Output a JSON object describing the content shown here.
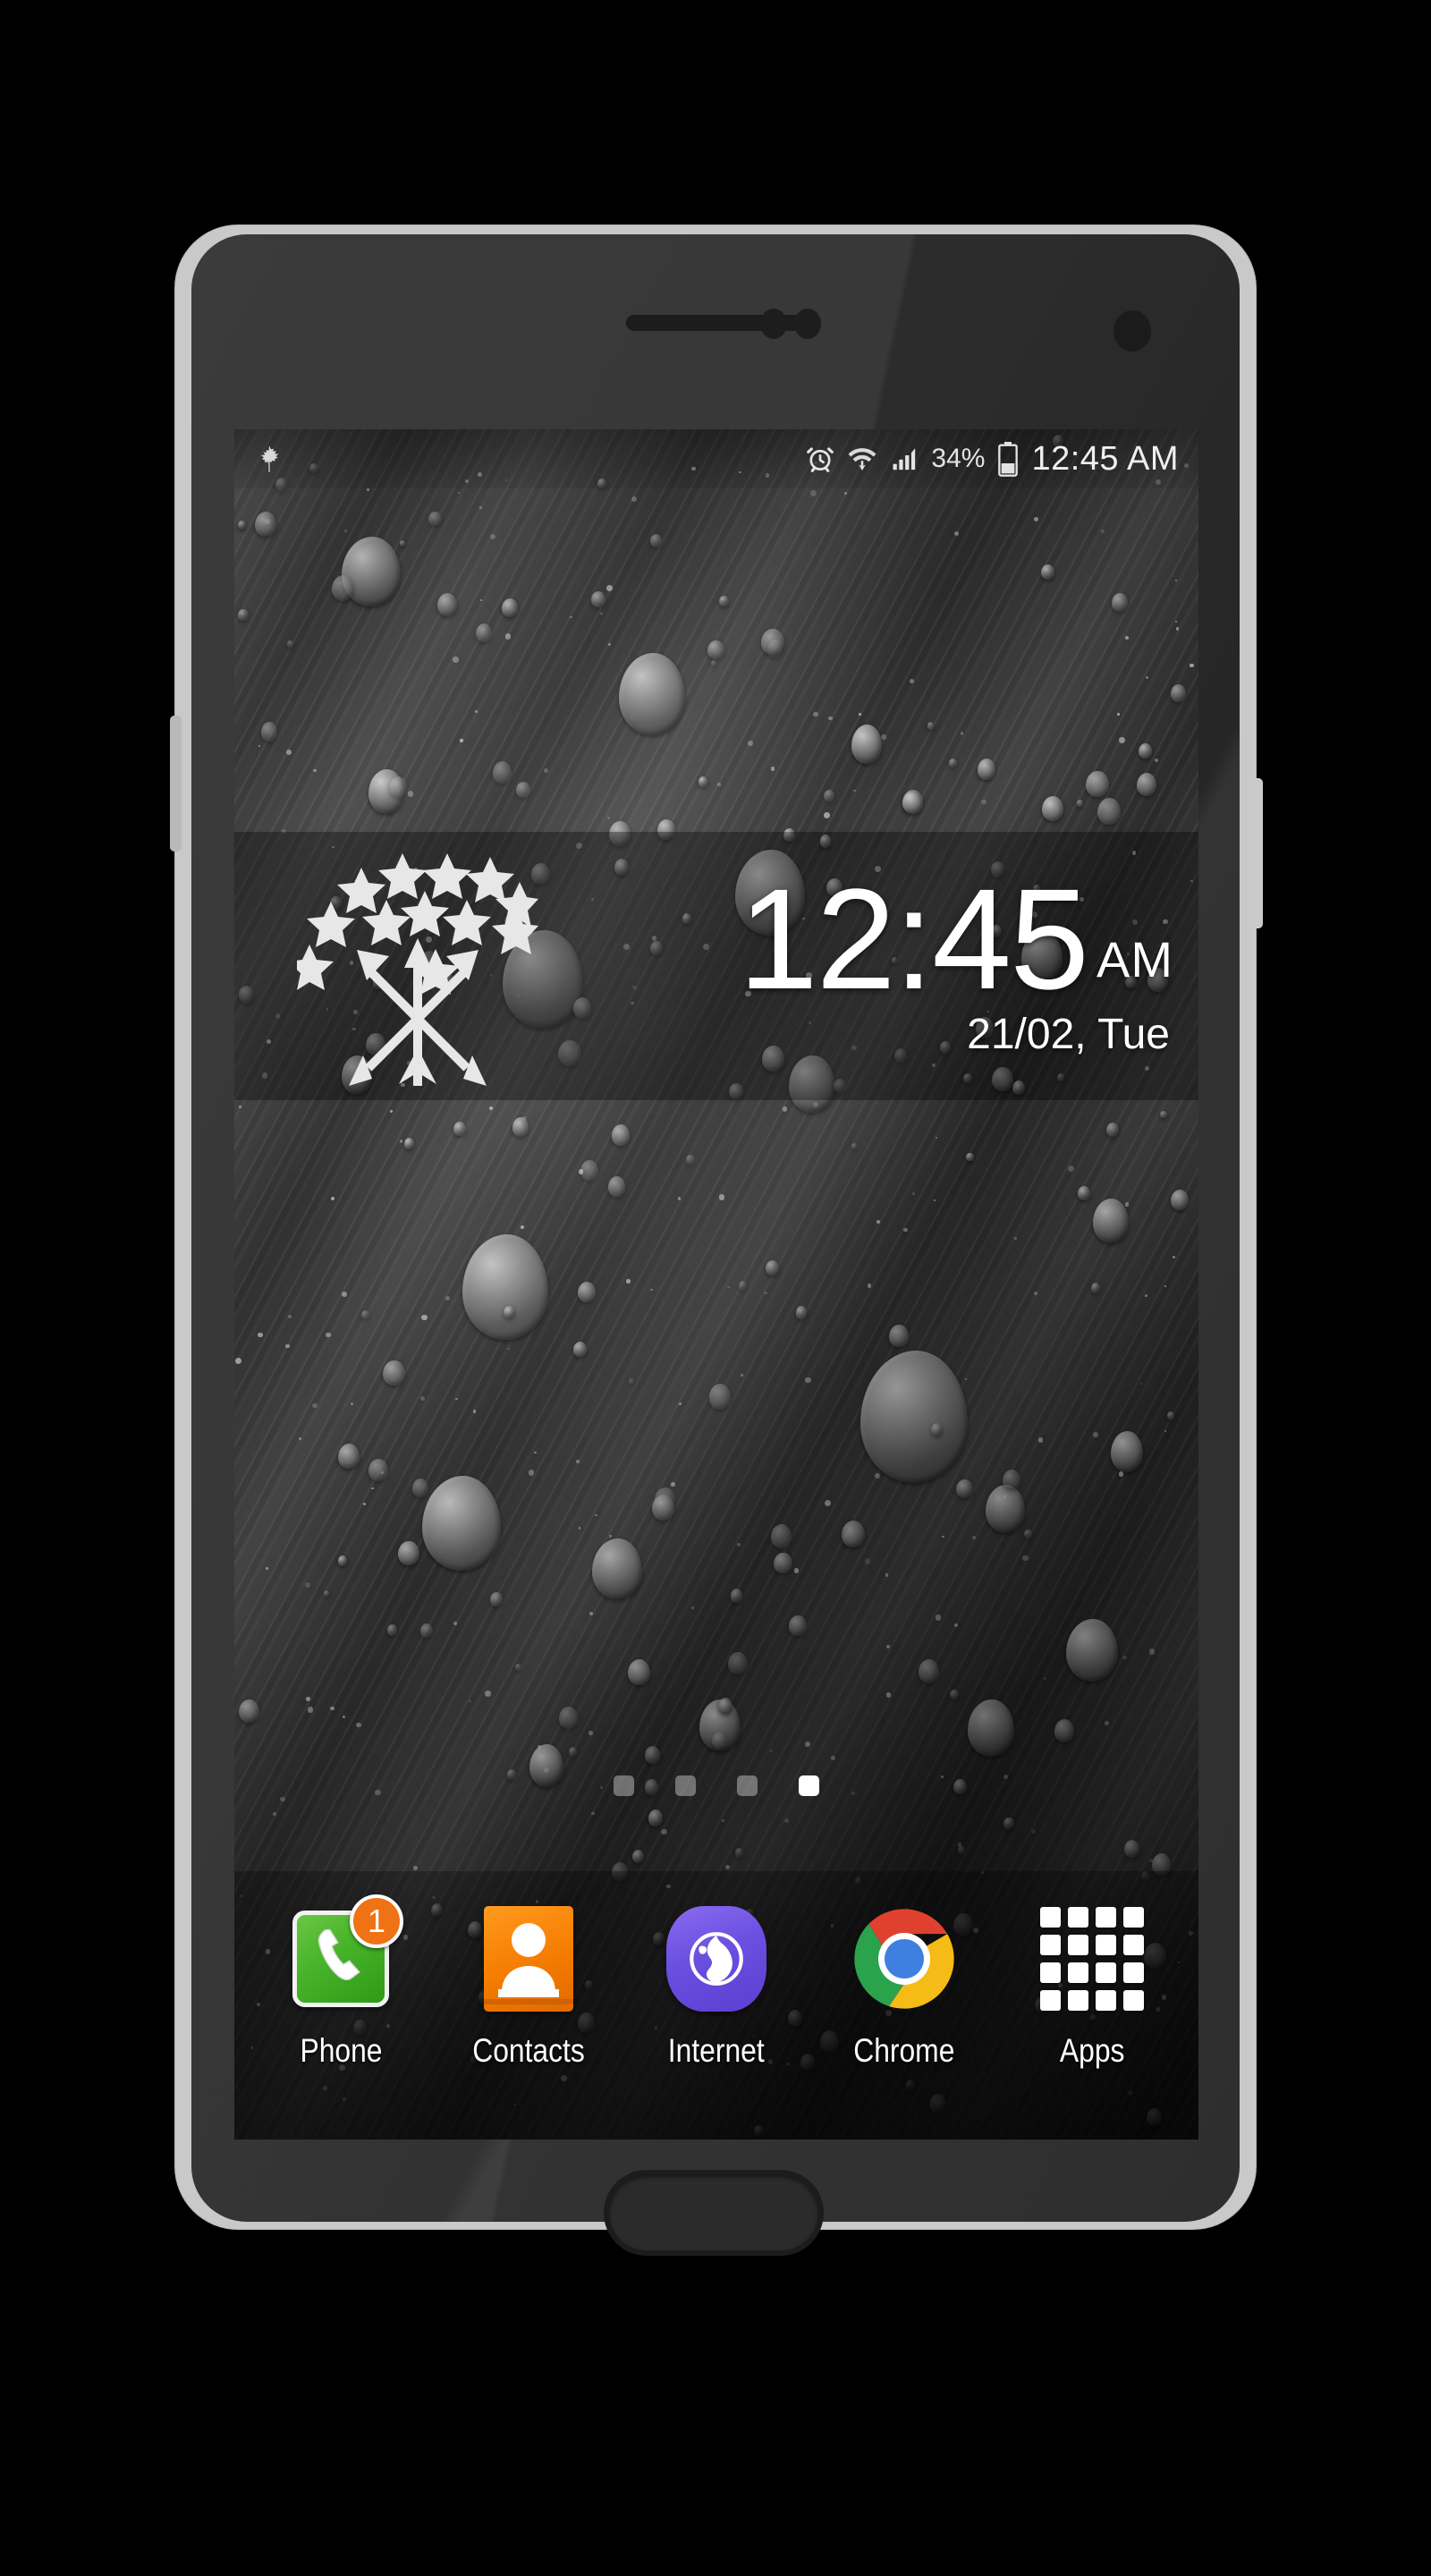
{
  "device": {
    "type": "android-smartphone",
    "bezel_color": "#c9c9c9",
    "body_color": "#2e2e2e",
    "hardware": {
      "earpiece": "earpiece-speaker",
      "front_camera": "front-camera",
      "home_button": "home-button",
      "power_button": "power-button",
      "volume_button": "volume-button"
    }
  },
  "status_bar": {
    "notification_icon": "maple-leaf-icon",
    "icons": [
      "alarm-icon",
      "wifi-icon",
      "signal-icon",
      "battery-icon"
    ],
    "battery_percent": "34%",
    "clock": "12:45 AM"
  },
  "clock_widget": {
    "emblem": "stars-and-arrows-emblem",
    "star_count": 13,
    "arrow_count": 3,
    "time": "12:45",
    "ampm": "AM",
    "date": "21/02, Tue"
  },
  "page_indicator": {
    "total": 4,
    "active_index": 3
  },
  "dock": {
    "items": [
      {
        "label": "Phone",
        "icon": "phone-icon",
        "badge": "1",
        "color": "#49b52b"
      },
      {
        "label": "Contacts",
        "icon": "contacts-icon",
        "badge": null,
        "color": "#f57c00"
      },
      {
        "label": "Internet",
        "icon": "globe-icon",
        "badge": null,
        "color": "#6a4fe0"
      },
      {
        "label": "Chrome",
        "icon": "chrome-icon",
        "badge": null,
        "color": "#4285f4"
      },
      {
        "label": "Apps",
        "icon": "apps-grid-icon",
        "badge": null,
        "color": "#ffffff"
      }
    ]
  },
  "wallpaper": {
    "description": "grayscale water droplets on brushed diagonal surface",
    "tone": "#3a3a3a"
  }
}
